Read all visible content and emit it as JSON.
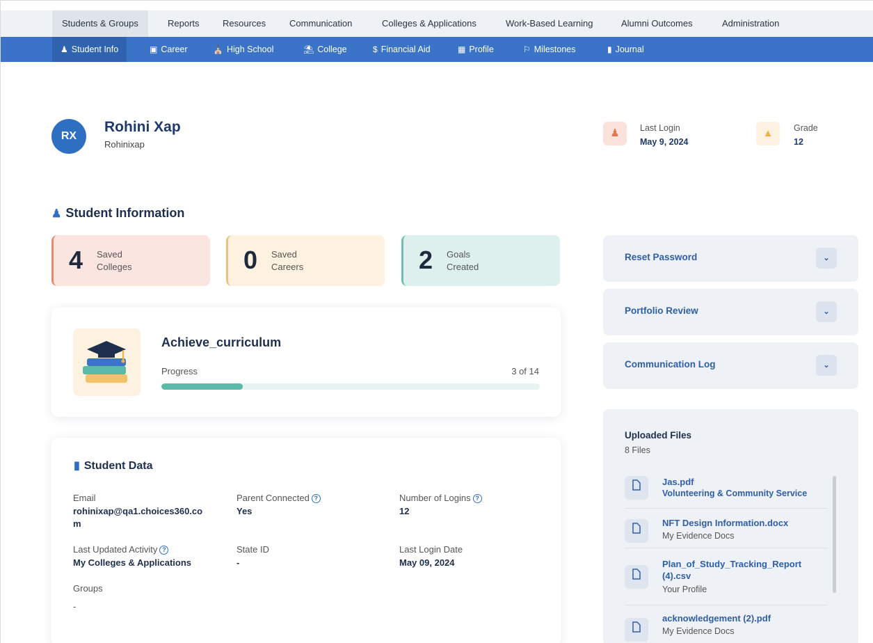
{
  "top_nav": [
    "Students & Groups",
    "Reports",
    "Resources",
    "Communication",
    "Colleges & Applications",
    "Work-Based Learning",
    "Alumni Outcomes",
    "Administration"
  ],
  "sub_nav": [
    "Student Info",
    "Career",
    "High School",
    "College",
    "Financial Aid",
    "Profile",
    "Milestones",
    "Journal"
  ],
  "profile": {
    "initials": "RX",
    "name": "Rohini Xap",
    "username": "Rohinixap"
  },
  "last_login": {
    "label": "Last Login",
    "value": "May 9, 2024"
  },
  "grade": {
    "label": "Grade",
    "value": "12"
  },
  "student_information_title": "Student Information",
  "counts": [
    {
      "num": "4",
      "line1": "Saved",
      "line2": "Colleges"
    },
    {
      "num": "0",
      "line1": "Saved",
      "line2": "Careers"
    },
    {
      "num": "2",
      "line1": "Goals",
      "line2": "Created"
    }
  ],
  "curriculum": {
    "title": "Achieve_curriculum",
    "progress_label": "Progress",
    "progress_text": "3 of 14",
    "progress_fraction": 0.2143
  },
  "student_data": {
    "title": "Student Data",
    "email_label": "Email",
    "email_line1": "rohinixap@qa1.choices360.co",
    "email_line2": "m",
    "parent_label": "Parent Connected",
    "parent_value": "Yes",
    "logins_label": "Number of Logins",
    "logins_value": "12",
    "activity_label": "Last Updated Activity",
    "activity_value": "My Colleges & Applications",
    "stateid_label": "State ID",
    "stateid_value": "-",
    "lastlogin_label": "Last Login Date",
    "lastlogin_value": "May 09, 2024",
    "groups_label": "Groups",
    "groups_value": "-"
  },
  "accordions": [
    "Reset Password",
    "Portfolio Review",
    "Communication Log"
  ],
  "uploaded_files": {
    "title": "Uploaded Files",
    "count": "8 Files",
    "files": [
      {
        "name": "Jas.pdf",
        "category": "Volunteering & Community Service"
      },
      {
        "name": "NFT Design Information.docx",
        "category": "My Evidence Docs"
      },
      {
        "name_line1": "Plan_of_Study_Tracking_Report",
        "name_line2": "(4).csv",
        "category": "Your Profile"
      },
      {
        "name": "acknowledgement (2).pdf",
        "category": "My Evidence Docs"
      }
    ]
  },
  "colors": {
    "primary": "#3a73c8",
    "progress": "#5bb9a8",
    "card_colleges": "#fbe5e0",
    "card_careers": "#fdf1df",
    "card_goals": "#def0ee"
  },
  "icons": {
    "student_info": "user-icon",
    "career": "briefcase-icon",
    "high_school": "school-icon",
    "college": "bank-icon",
    "financial_aid": "dollar-icon",
    "profile": "id-card-icon",
    "milestones": "flag-icon",
    "journal": "book-icon"
  }
}
